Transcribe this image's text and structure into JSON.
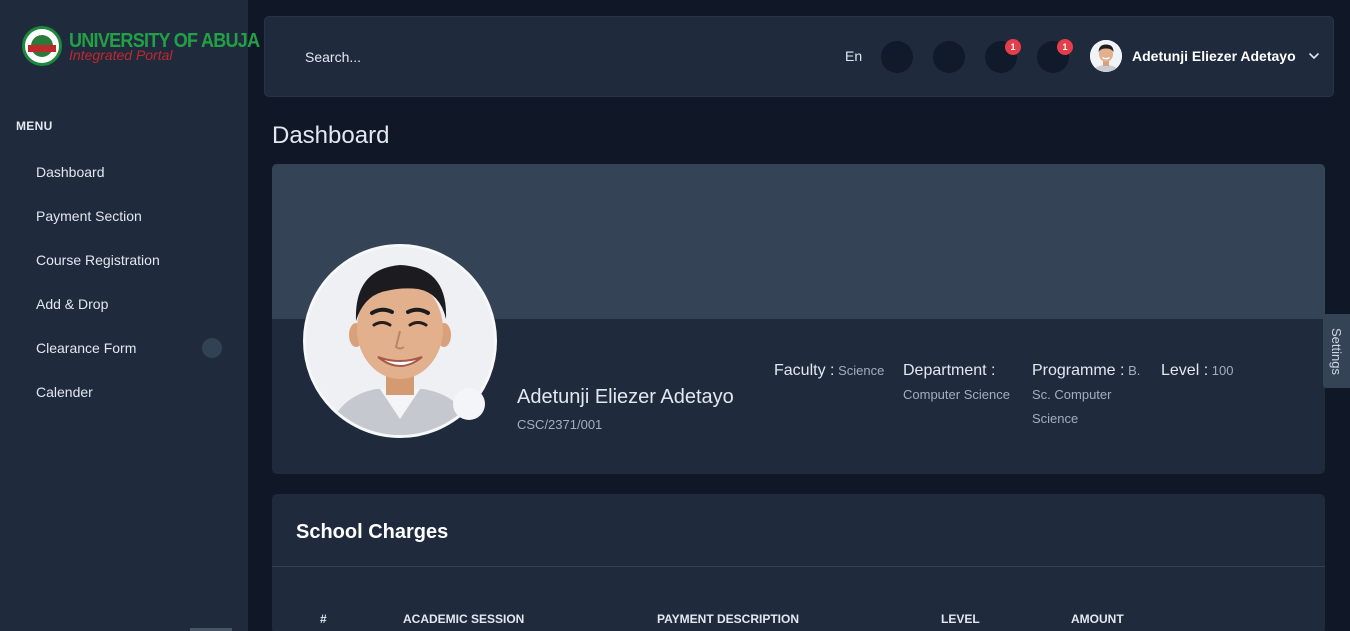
{
  "brand": {
    "title": "UNIVERSITY OF ABUJA",
    "subtitle": "Integrated Portal",
    "colors": {
      "title": "#23a046",
      "subtitle": "#c0292b"
    }
  },
  "sidebar": {
    "menu_title": "MENU",
    "items": [
      {
        "label": "Dashboard"
      },
      {
        "label": "Payment Section"
      },
      {
        "label": "Course Registration"
      },
      {
        "label": "Add & Drop"
      },
      {
        "label": "Clearance Form"
      },
      {
        "label": "Calender"
      }
    ]
  },
  "topbar": {
    "search_placeholder": "Search...",
    "language": "En",
    "icons": [
      {
        "name": "apps-icon"
      },
      {
        "name": "fullscreen-icon"
      },
      {
        "name": "notification-icon",
        "badge": "1"
      },
      {
        "name": "message-icon",
        "badge": "1"
      }
    ],
    "user_name": "Adetunji Eliezer Adetayo"
  },
  "page": {
    "title": "Dashboard"
  },
  "profile": {
    "name": "Adetunji Eliezer Adetayo",
    "matric": "CSC/2371/001",
    "faculty_label": "Faculty :",
    "faculty": "Science",
    "department_label": "Department :",
    "department": "Computer Science",
    "programme_label": "Programme :",
    "programme": "B. Sc. Computer Science",
    "level_label": "Level :",
    "level": "100"
  },
  "settings_tab": "Settings",
  "charges": {
    "title": "School Charges",
    "columns": [
      "#",
      "ACADEMIC SESSION",
      "PAYMENT DESCRIPTION",
      "LEVEL",
      "AMOUNT"
    ]
  },
  "colors": {
    "background": "#101828",
    "panel": "#1f2a3d",
    "cover": "#344456",
    "badge": "#e53e4b"
  }
}
